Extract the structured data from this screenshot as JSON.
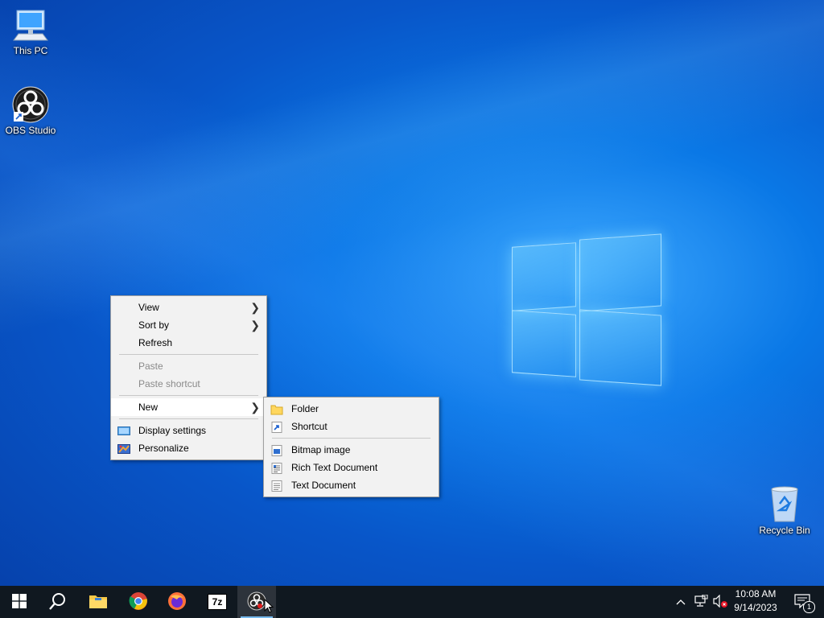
{
  "desktop": {
    "icons": [
      {
        "label": "This PC",
        "icon": "monitor-icon"
      },
      {
        "label": "OBS Studio",
        "icon": "obs-icon"
      },
      {
        "label": "Recycle Bin",
        "icon": "recycle-bin-icon"
      }
    ]
  },
  "context_menu": {
    "items": [
      {
        "label": "View",
        "has_submenu": true
      },
      {
        "label": "Sort by",
        "has_submenu": true
      },
      {
        "label": "Refresh"
      },
      {
        "label": "Paste",
        "disabled": true
      },
      {
        "label": "Paste shortcut",
        "disabled": true
      },
      {
        "label": "New",
        "has_submenu": true,
        "highlighted": true
      },
      {
        "label": "Display settings",
        "icon": "display-settings-icon"
      },
      {
        "label": "Personalize",
        "icon": "personalize-icon"
      }
    ]
  },
  "new_submenu": {
    "items": [
      {
        "label": "Folder",
        "icon": "folder-icon"
      },
      {
        "label": "Shortcut",
        "icon": "shortcut-icon"
      },
      {
        "label": "Bitmap image",
        "icon": "bitmap-icon"
      },
      {
        "label": "Rich Text Document",
        "icon": "rtf-document-icon"
      },
      {
        "label": "Text Document",
        "icon": "text-document-icon"
      }
    ]
  },
  "taskbar": {
    "apps": [
      {
        "name": "start",
        "icon": "windows-start-icon"
      },
      {
        "name": "search",
        "icon": "search-icon"
      },
      {
        "name": "file-explorer",
        "icon": "folder-icon"
      },
      {
        "name": "chrome",
        "icon": "chrome-icon"
      },
      {
        "name": "firefox",
        "icon": "firefox-icon"
      },
      {
        "name": "7zip",
        "icon": "7zip-icon",
        "label": "7z"
      },
      {
        "name": "obs",
        "icon": "obs-icon",
        "active": true
      }
    ],
    "tray": {
      "time": "10:08 AM",
      "date": "9/14/2023",
      "notification_count": "1"
    }
  },
  "colors": {
    "accent": "#0a78e6",
    "menu_bg": "#f2f2f2",
    "taskbar_bg": "#101820"
  }
}
